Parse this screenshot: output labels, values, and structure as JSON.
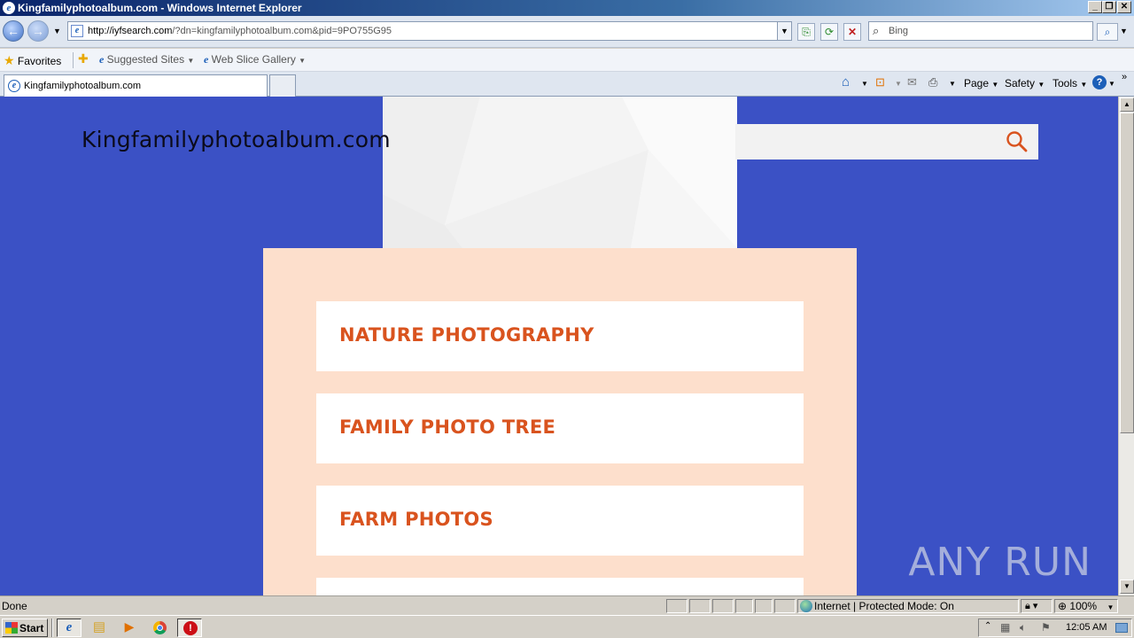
{
  "window": {
    "title": "Kingfamilyphotoalbum.com - Windows Internet Explorer",
    "minimize": "_",
    "restore": "❐",
    "close": "✕"
  },
  "nav": {
    "url_host": "http://iyfsearch.com",
    "url_rest": "/?dn=kingfamilyphotoalbum.com&pid=9PO755G95",
    "search_placeholder": "Bing"
  },
  "favorites_bar": {
    "favorites": "Favorites",
    "suggested_sites": "Suggested Sites",
    "web_slice_gallery": "Web Slice Gallery"
  },
  "tabs": [
    {
      "label": "Kingfamilyphotoalbum.com"
    }
  ],
  "command_bar": {
    "page": "Page",
    "safety": "Safety",
    "tools": "Tools"
  },
  "site": {
    "title": "Kingfamilyphotoalbum.com",
    "links": [
      "NATURE PHOTOGRAPHY",
      "FAMILY PHOTO TREE",
      "FARM PHOTOS"
    ],
    "accent_color": "#d9531e",
    "background_color": "#3b51c5",
    "panel_color": "#fddfcc"
  },
  "watermark": "ANY RUN",
  "status": {
    "text": "Done",
    "zone": "Internet | Protected Mode: On",
    "zoom": "100%"
  },
  "taskbar": {
    "start": "Start",
    "clock": "12:05 AM"
  }
}
